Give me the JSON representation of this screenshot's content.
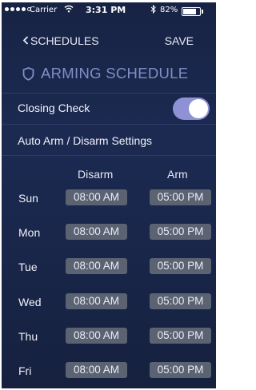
{
  "status_bar": {
    "carrier": "Carrier",
    "time": "3:31 PM",
    "battery": "82%"
  },
  "nav": {
    "back_label": "SCHEDULES",
    "save_label": "SAVE"
  },
  "page": {
    "title": "ARMING SCHEDULE"
  },
  "closing_check": {
    "label": "Closing Check",
    "enabled": true
  },
  "auto_arm": {
    "label": "Auto Arm / Disarm Settings"
  },
  "schedule": {
    "disarm_header": "Disarm",
    "arm_header": "Arm",
    "rows": [
      {
        "day": "Sun",
        "disarm": "08:00 AM",
        "arm": "05:00 PM"
      },
      {
        "day": "Mon",
        "disarm": "08:00 AM",
        "arm": "05:00 PM"
      },
      {
        "day": "Tue",
        "disarm": "08:00 AM",
        "arm": "05:00 PM"
      },
      {
        "day": "Wed",
        "disarm": "08:00 AM",
        "arm": "05:00 PM"
      },
      {
        "day": "Thu",
        "disarm": "08:00 AM",
        "arm": "05:00 PM"
      },
      {
        "day": "Fri",
        "disarm": "08:00 AM",
        "arm": "05:00 PM"
      }
    ]
  },
  "colors": {
    "background": "#1c2a52",
    "accent_title": "#7f8fc4",
    "toggle_on": "#8e91d4",
    "time_button": "#5b6373"
  }
}
